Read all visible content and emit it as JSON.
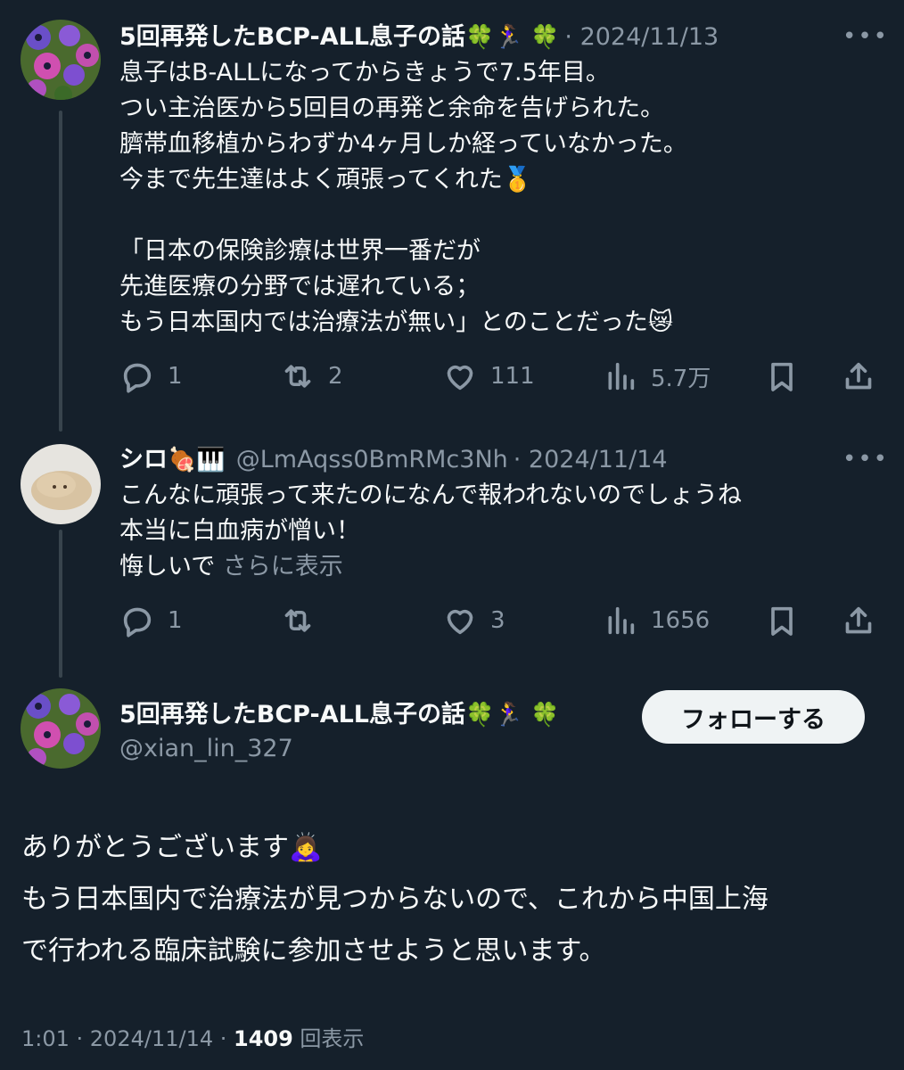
{
  "tweet1": {
    "name": "5回再発したBCP-ALL息子の話",
    "name_emoji": "🍀🏃‍♀️ 🍀",
    "date": "· 2024/11/13",
    "more": "•••",
    "text": "息子はB-ALLになってからきょうで7.5年目。\nつい主治医から5回目の再発と余命を告げられた。\n臍帯血移植からわずか4ヶ月しか経っていなかった。\n今まで先生達はよく頑張ってくれた🥇\n\n「日本の保険診療は世界一番だが\n先進医療の分野では遅れている；\nもう日本国内では治療法が無い」とのことだった😿",
    "replies": "1",
    "retweets": "2",
    "likes": "111",
    "views": "5.7万"
  },
  "tweet2": {
    "name": "シロ",
    "name_emoji": "🍖🎹",
    "handle": "@LmAqss0BmRMc3Nh",
    "date": "· 2024/11/14",
    "more": "•••",
    "text": "こんなに頑張って来たのになんで報われないのでしょうね\n本当に白血病が憎い！\n悔しいで",
    "show_more": "さらに表示",
    "replies": "1",
    "retweets": "",
    "likes": "3",
    "views": "1656"
  },
  "main": {
    "name": "5回再発したBCP-ALL息子の話",
    "name_emoji": "🍀🏃‍♀️ 🍀",
    "handle": "@xian_lin_327",
    "follow_label": "フォローする",
    "text": "ありがとうございます🙇‍♀️\nもう日本国内で治療法が見つからないので、これから中国上海\nで行われる臨床試験に参加させようと思います。",
    "time": "1:01 · 2024/11/14 · ",
    "views_count": "1409",
    "views_label": " 回表示"
  },
  "icons": [
    "reply-icon",
    "retweet-icon",
    "like-icon",
    "views-icon",
    "bookmark-icon",
    "share-icon",
    "more-icon"
  ]
}
